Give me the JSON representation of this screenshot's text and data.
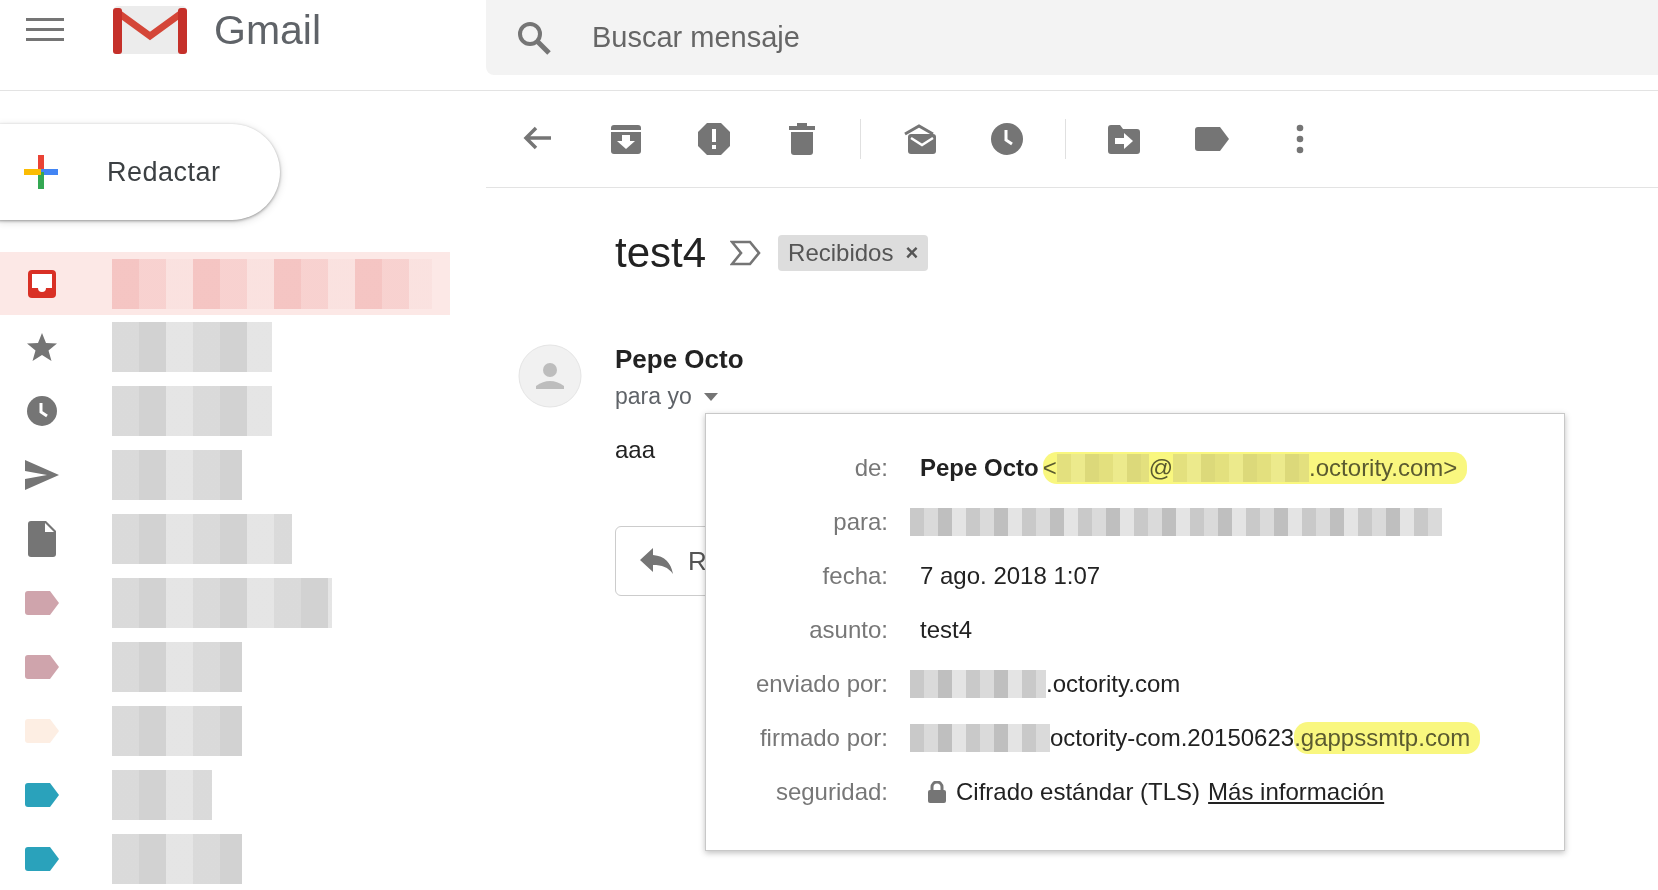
{
  "header": {
    "app_name": "Gmail",
    "search": {
      "placeholder": "Buscar mensaje"
    }
  },
  "compose": {
    "label": "Redactar"
  },
  "sidebar": {
    "items": [
      {
        "kind": "inbox",
        "selected": true
      },
      {
        "kind": "starred",
        "selected": false
      },
      {
        "kind": "snoozed",
        "selected": false
      },
      {
        "kind": "sent",
        "selected": false
      },
      {
        "kind": "drafts",
        "selected": false
      },
      {
        "kind": "label",
        "color": "#cfa4ac",
        "selected": false
      },
      {
        "kind": "label",
        "color": "#cfa4ac",
        "selected": false
      },
      {
        "kind": "label",
        "color": "#fdeee3",
        "selected": false
      },
      {
        "kind": "label",
        "color": "#2aa2bb",
        "selected": false
      },
      {
        "kind": "label",
        "color": "#2aa2bb",
        "selected": false
      }
    ]
  },
  "message": {
    "subject": "test4",
    "label_chip": {
      "text": "Recibidos",
      "remove": "×"
    },
    "sender": "Pepe Octo",
    "recipient_toggle": "para yo",
    "body": "aaa",
    "reply_button": "R"
  },
  "details": {
    "rows": [
      {
        "label": "de:",
        "parts": [
          {
            "kind": "name",
            "text": "Pepe Octo"
          },
          {
            "kind": "text",
            "text": "<",
            "highlight": true
          },
          {
            "kind": "blur",
            "highlight": true
          },
          {
            "kind": "text",
            "text": "@",
            "highlight": true
          },
          {
            "kind": "blur",
            "highlight": true
          },
          {
            "kind": "text",
            "text": ".octority.com>",
            "highlight": true
          }
        ]
      },
      {
        "label": "para:",
        "parts": [
          {
            "kind": "blur"
          }
        ]
      },
      {
        "label": "fecha:",
        "parts": [
          {
            "kind": "text",
            "text": "7 ago. 2018 1:07"
          }
        ]
      },
      {
        "label": "asunto:",
        "parts": [
          {
            "kind": "text",
            "text": "test4"
          }
        ]
      },
      {
        "label": "enviado por:",
        "parts": [
          {
            "kind": "blur"
          },
          {
            "kind": "text",
            "text": ".octority.com"
          }
        ]
      },
      {
        "label": "firmado por:",
        "parts": [
          {
            "kind": "blur"
          },
          {
            "kind": "text",
            "text": "octority-com.20150623"
          },
          {
            "kind": "text",
            "text": ".gappssmtp.com",
            "highlight": true
          }
        ]
      },
      {
        "label": "seguridad:",
        "parts": [
          {
            "kind": "lock"
          },
          {
            "kind": "text",
            "text": "Cifrado estándar (TLS)"
          },
          {
            "kind": "link",
            "text": "Más información"
          }
        ]
      }
    ]
  }
}
